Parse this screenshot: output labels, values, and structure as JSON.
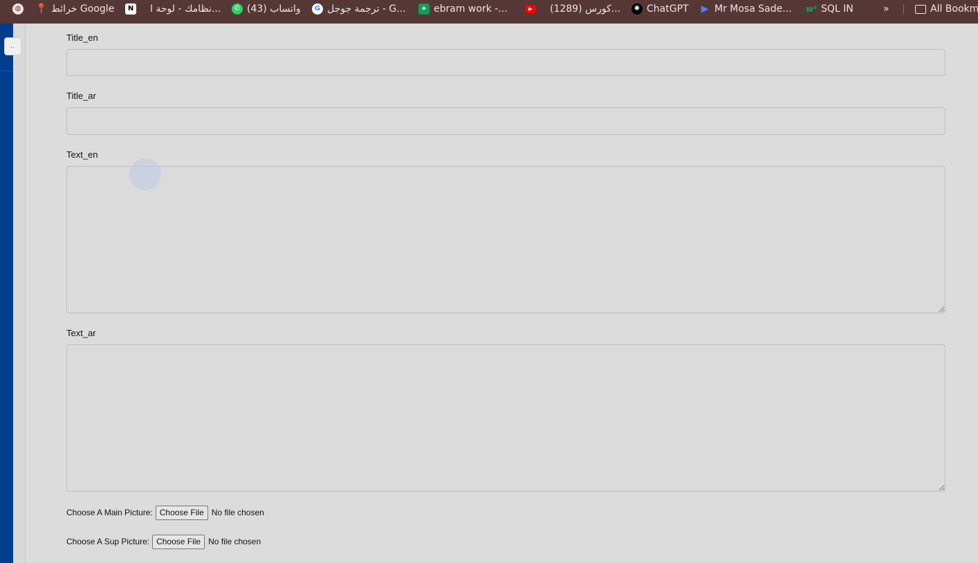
{
  "bookmarks": {
    "items": [
      {
        "label": "",
        "icon": "globe-icon"
      },
      {
        "label": "خرائط Google",
        "icon": "maps-icon"
      },
      {
        "label": "نظامك - لوحة ا...",
        "icon": "notion-icon"
      },
      {
        "label": "(43) واتساب",
        "icon": "whatsapp-icon"
      },
      {
        "label": "ترجمة جوجل - G...",
        "icon": "google-icon"
      },
      {
        "label": "ebram work -...",
        "icon": "sheets-icon"
      },
      {
        "label": "(1289) كورس...",
        "icon": "youtube-icon"
      },
      {
        "label": "ChatGPT",
        "icon": "chatgpt-icon"
      },
      {
        "label": "Mr Mosa Sade...",
        "icon": "play-icon"
      },
      {
        "label": "SQL IN",
        "icon": "w3-icon"
      }
    ],
    "overflow": "»",
    "all_bookmarks": "All Bookm"
  },
  "sidebar": {
    "collapse_glyph": "←"
  },
  "form": {
    "title_en_label": "Title_en",
    "title_ar_label": "Title_ar",
    "text_en_label": "Text_en",
    "text_ar_label": "Text_ar",
    "main_picture_label": "Choose A Main Picture:",
    "sup_picture_label": "Choose A Sup Picture:",
    "choose_file": "Choose File",
    "no_file": "No file chosen"
  }
}
